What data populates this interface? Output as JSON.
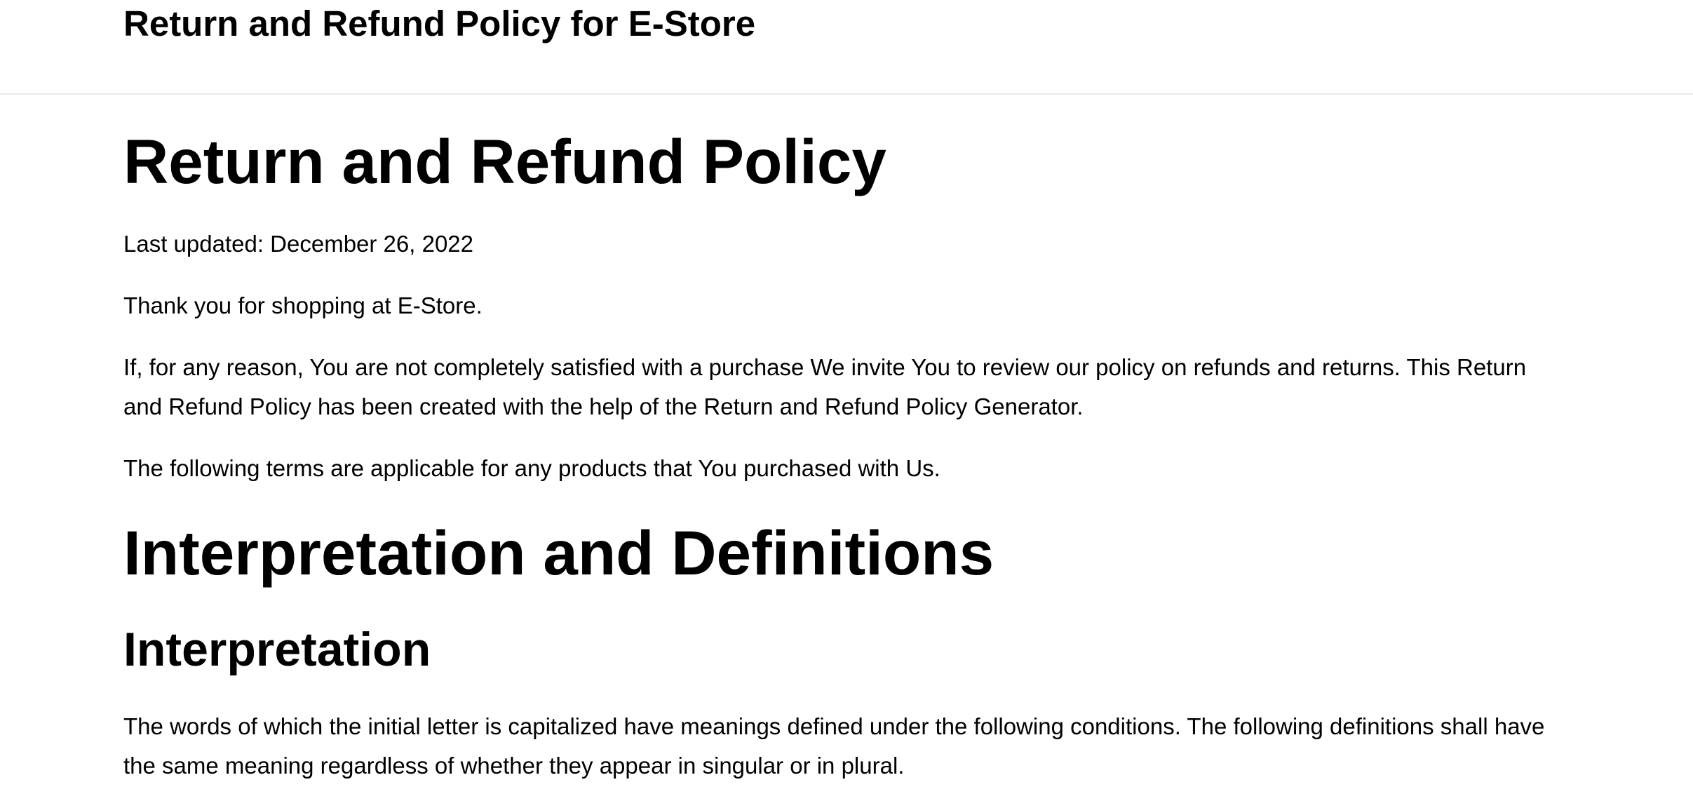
{
  "header": {
    "site_title": "Return and Refund Policy for E-Store"
  },
  "main": {
    "page_title": "Return and Refund Policy",
    "last_updated": "Last updated: December 26, 2022",
    "thank_you": "Thank you for shopping at E-Store.",
    "intro_paragraph": "If, for any reason, You are not completely satisfied with a purchase We invite You to review our policy on refunds and returns. This Return and Refund Policy has been created with the help of the Return and Refund Policy Generator.",
    "terms_paragraph": "The following terms are applicable for any products that You purchased with Us.",
    "section_heading": "Interpretation and Definitions",
    "subsection_heading": "Interpretation",
    "interpretation_paragraph": "The words of which the initial letter is capitalized have meanings defined under the following conditions. The following definitions shall have the same meaning regardless of whether they appear in singular or in plural."
  },
  "colors": {
    "background": "#ffffff",
    "text": "#000000",
    "header_divider": "#e9e9e9"
  }
}
